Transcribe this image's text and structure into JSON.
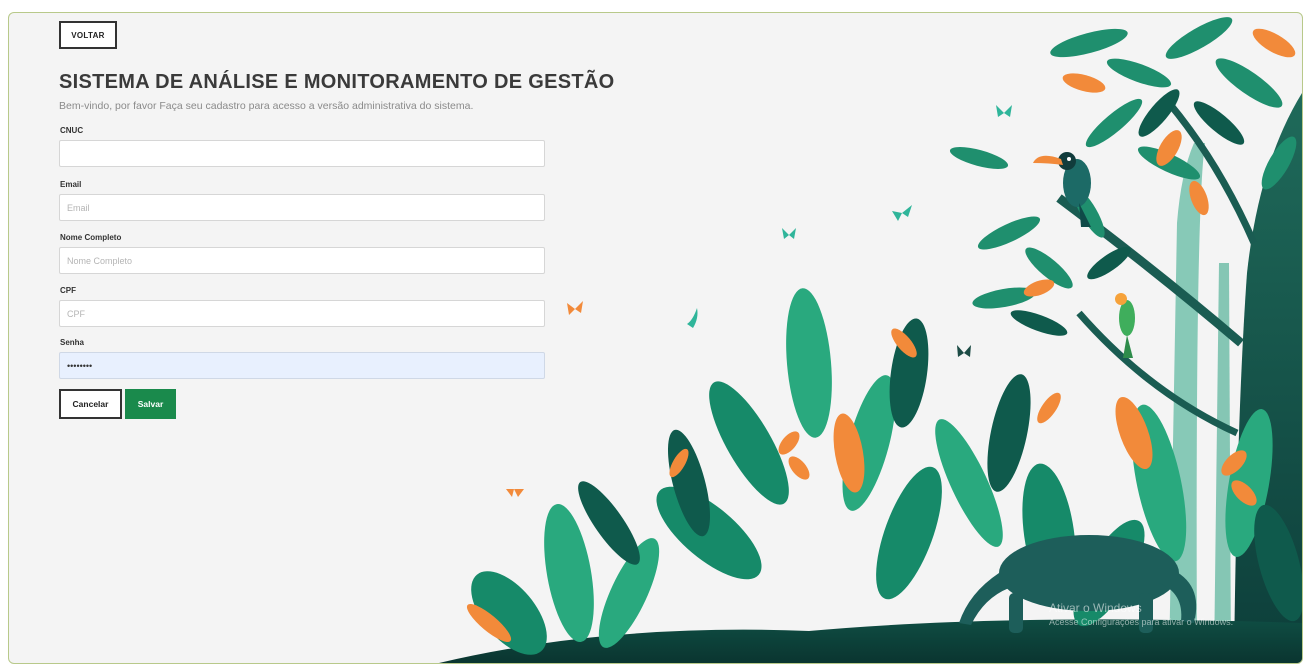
{
  "header": {
    "back_button": "VOLTAR",
    "title": "SISTEMA DE ANÁLISE E MONITORAMENTO DE GESTÃO",
    "subtitle": "Bem-vindo, por favor Faça seu cadastro para acesso a versão administrativa do sistema."
  },
  "form": {
    "cnuc": {
      "label": "CNUC",
      "value": "",
      "placeholder": ""
    },
    "email": {
      "label": "Email",
      "value": "",
      "placeholder": "Email"
    },
    "nome": {
      "label": "Nome Completo",
      "value": "",
      "placeholder": "Nome Completo"
    },
    "cpf": {
      "label": "CPF",
      "value": "",
      "placeholder": "CPF"
    },
    "senha": {
      "label": "Senha",
      "value": "••••••••",
      "placeholder": ""
    }
  },
  "actions": {
    "cancel": "Cancelar",
    "save": "Salvar"
  },
  "illustration": {
    "name": "rainforest-illustration"
  },
  "watermark": {
    "line1": "Ativar o Windows",
    "line2": "Acesse Configurações para ativar o Windows."
  },
  "colors": {
    "primary": "#1a8a4c",
    "background": "#f4f4f4",
    "frame_border": "#b8c98a"
  }
}
